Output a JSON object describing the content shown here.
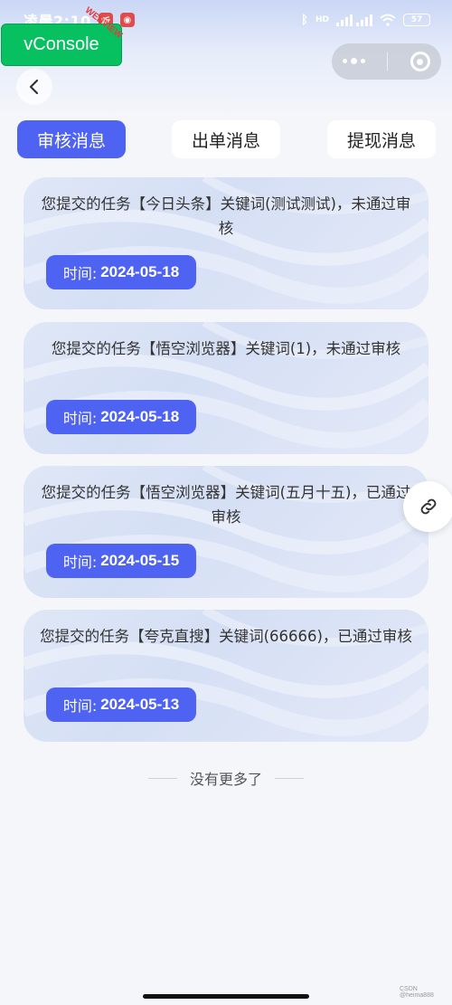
{
  "status_bar": {
    "time": "凌晨2:10",
    "badge_1": "听",
    "network": "HD",
    "battery": "57"
  },
  "vconsole": {
    "label": "vConsole",
    "tag": "WEBVIEW"
  },
  "tabs": [
    {
      "label": "审核消息",
      "active": true
    },
    {
      "label": "出单消息",
      "active": false
    },
    {
      "label": "提现消息",
      "active": false
    }
  ],
  "messages": [
    {
      "text": "您提交的任务【今日头条】关键词(测试测试)，未通过审核",
      "time_label": "时间:",
      "date": "2024-05-18"
    },
    {
      "text": "您提交的任务【悟空浏览器】关键词(1)，未通过审核",
      "time_label": "时间:",
      "date": "2024-05-18"
    },
    {
      "text": "您提交的任务【悟空浏览器】关键词(五月十五)，已通过审核",
      "time_label": "时间:",
      "date": "2024-05-15"
    },
    {
      "text": "您提交的任务【夸克直搜】关键词(66666)，已通过审核",
      "time_label": "时间:",
      "date": "2024-05-13"
    }
  ],
  "footer": {
    "no_more": "没有更多了",
    "watermark": "CSDN @heima888"
  },
  "colors": {
    "accent": "#4f63f2",
    "vconsole": "#07c160",
    "background": "#f5f6fa"
  }
}
